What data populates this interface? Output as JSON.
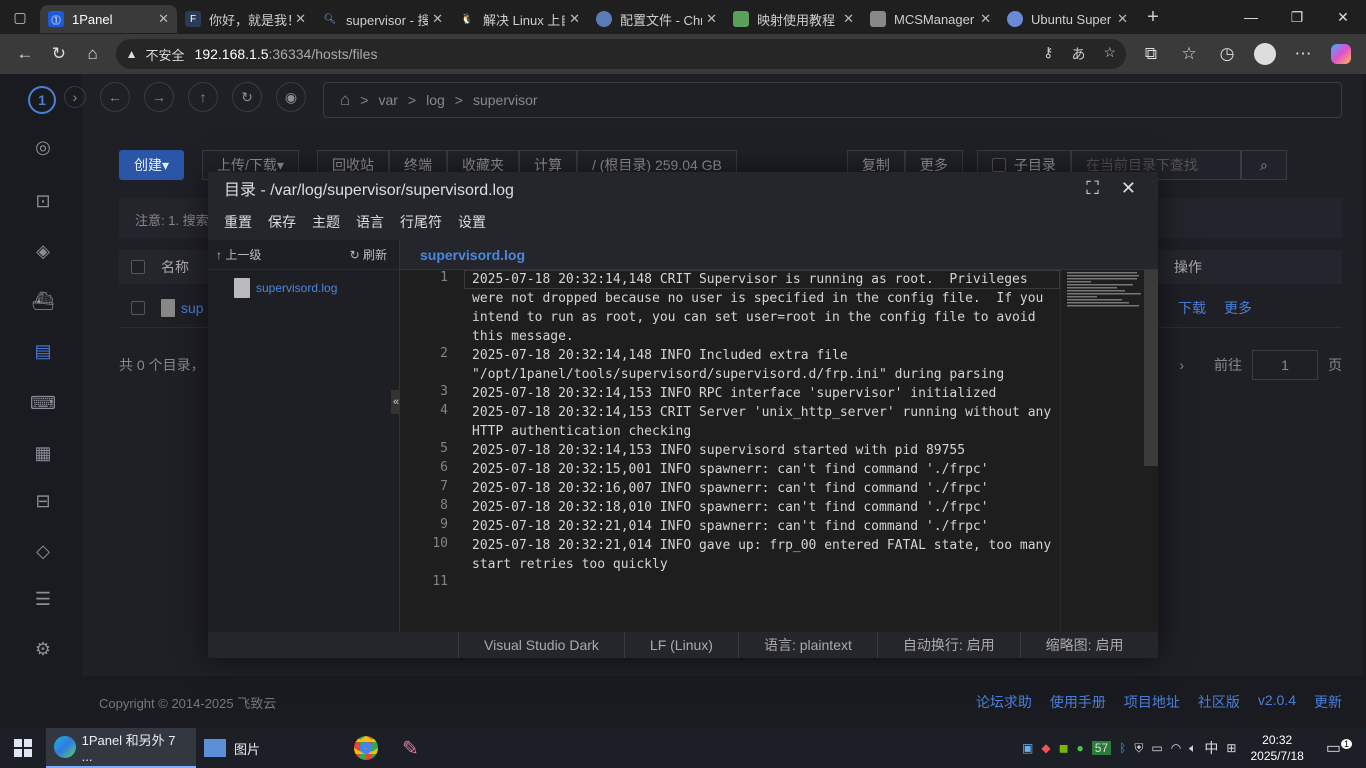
{
  "browser": {
    "tabs": [
      {
        "title": "1Panel",
        "active": true
      },
      {
        "title": "你好，就是我！",
        "active": false
      },
      {
        "title": "supervisor - 搜",
        "active": false
      },
      {
        "title": "解决 Linux 上自",
        "active": false
      },
      {
        "title": "配置文件 - Chr",
        "active": false
      },
      {
        "title": "映射使用教程",
        "active": false
      },
      {
        "title": "MCSManager",
        "active": false
      },
      {
        "title": "Ubuntu Super",
        "active": false
      }
    ],
    "address": {
      "security": "不安全",
      "host": "192.168.1.5",
      "rest": ":36334/hosts/files"
    }
  },
  "app": {
    "breadcrumb": [
      "var",
      "log",
      "supervisor"
    ],
    "toolbar": {
      "create": "创建",
      "upload": "上传/下载",
      "recycle": "回收站",
      "terminal": "终端",
      "favorites": "收藏夹",
      "calc": "计算",
      "root": "/ (根目录) 259.04 GB",
      "copy": "复制",
      "more": "更多",
      "subdir": "子目录",
      "search_placeholder": "在当前目录下查找"
    },
    "notice": "注意: 1. 搜索",
    "table": {
      "col_name": "名称",
      "col_ops": "操作",
      "row_name": "sup",
      "row_download": "下载",
      "row_more": "更多"
    },
    "pager": {
      "summary": "共 0 个目录，",
      "goto": "前往",
      "page": "1",
      "page_unit": "页"
    },
    "footer": {
      "copyright": "Copyright © 2014-2025 飞致云",
      "links": [
        "论坛求助",
        "使用手册",
        "项目地址",
        "社区版",
        "v2.0.4",
        "更新"
      ]
    }
  },
  "dialog": {
    "title": "目录 - /var/log/supervisor/supervisord.log",
    "menu": [
      "重置",
      "保存",
      "主题",
      "语言",
      "行尾符",
      "设置"
    ],
    "tree": {
      "up": "上一级",
      "refresh": "刷新",
      "file": "supervisord.log"
    },
    "tab": "supervisord.log",
    "lines": [
      "2025-07-18 20:32:14,148 CRIT Supervisor is running as root.  Privileges were not dropped because no user is specified in the config file.  If you intend to run as root, you can set user=root in the config file to avoid this message.",
      "2025-07-18 20:32:14,148 INFO Included extra file \"/opt/1panel/tools/supervisord/supervisord.d/frp.ini\" during parsing",
      "2025-07-18 20:32:14,153 INFO RPC interface 'supervisor' initialized",
      "2025-07-18 20:32:14,153 CRIT Server 'unix_http_server' running without any HTTP authentication checking",
      "2025-07-18 20:32:14,153 INFO supervisord started with pid 89755",
      "2025-07-18 20:32:15,001 INFO spawnerr: can't find command './frpc'",
      "2025-07-18 20:32:16,007 INFO spawnerr: can't find command './frpc'",
      "2025-07-18 20:32:18,010 INFO spawnerr: can't find command './frpc'",
      "2025-07-18 20:32:21,014 INFO spawnerr: can't find command './frpc'",
      "2025-07-18 20:32:21,014 INFO gave up: frp_00 entered FATAL state, too many start retries too quickly",
      ""
    ],
    "status": [
      "Visual Studio Dark",
      "LF (Linux)",
      "语言: plaintext",
      "自动换行: 启用",
      "缩略图: 启用"
    ]
  },
  "taskbar": {
    "apps": [
      {
        "label": "1Panel 和另外 7 ..."
      },
      {
        "label": "图片"
      }
    ],
    "ime": "中",
    "tray_badge": "57",
    "time": "20:32",
    "date": "2025/7/18",
    "notif_count": "1"
  }
}
